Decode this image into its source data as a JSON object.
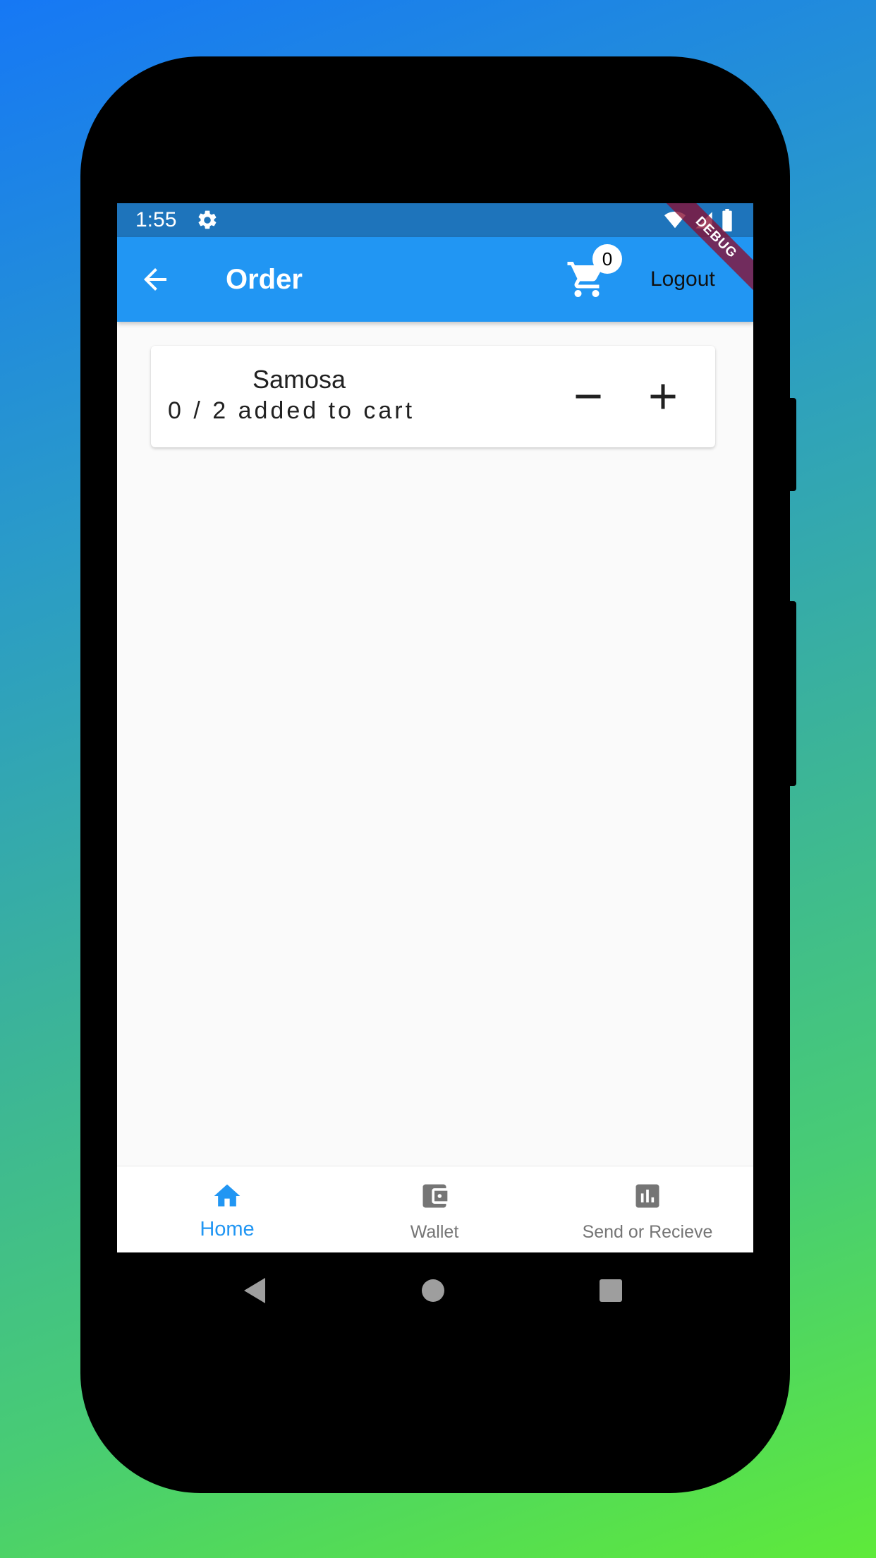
{
  "status_bar": {
    "time": "1:55",
    "icons": [
      "gear-icon",
      "wifi-icon",
      "signal-icon",
      "battery-icon"
    ]
  },
  "debug_banner": "DEBUG",
  "app_bar": {
    "title": "Order",
    "cart_count": "0",
    "logout_label": "Logout"
  },
  "items": [
    {
      "name": "Samosa",
      "count_text": "0 / 2 added to cart"
    }
  ],
  "bottom_nav": {
    "items": [
      {
        "label": "Home",
        "icon": "home-icon",
        "active": true
      },
      {
        "label": "Wallet",
        "icon": "wallet-icon",
        "active": false
      },
      {
        "label": "Send or Recieve",
        "icon": "bar-chart-icon",
        "active": false
      }
    ]
  },
  "colors": {
    "primary": "#2196f3",
    "status_bar": "#1e74bb",
    "inactive": "#757575",
    "debug": "#880e32"
  }
}
